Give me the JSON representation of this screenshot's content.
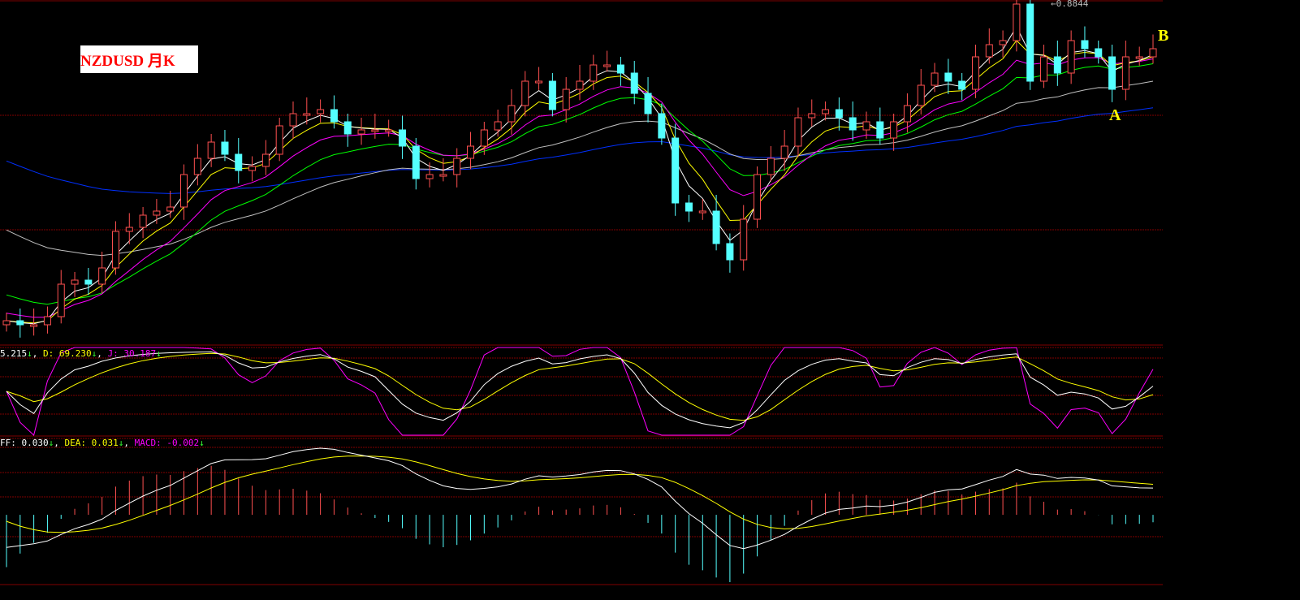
{
  "chart_data": {
    "type": "candlestick",
    "title": "NZDUSD 月K",
    "high_label": "0.8844",
    "annotations": [
      "A",
      "B"
    ],
    "closes": [
      0.416,
      0.41,
      0.41,
      0.422,
      0.47,
      0.476,
      0.47,
      0.494,
      0.548,
      0.554,
      0.572,
      0.578,
      0.584,
      0.632,
      0.656,
      0.68,
      0.662,
      0.638,
      0.644,
      0.662,
      0.704,
      0.722,
      0.722,
      0.728,
      0.71,
      0.692,
      0.698,
      0.698,
      0.698,
      0.674,
      0.626,
      0.632,
      0.632,
      0.656,
      0.674,
      0.698,
      0.71,
      0.734,
      0.77,
      0.77,
      0.728,
      0.758,
      0.77,
      0.794,
      0.794,
      0.782,
      0.752,
      0.722,
      0.686,
      0.59,
      0.578,
      0.578,
      0.53,
      0.506,
      0.566,
      0.632,
      0.656,
      0.674,
      0.716,
      0.722,
      0.728,
      0.716,
      0.698,
      0.71,
      0.686,
      0.71,
      0.734,
      0.764,
      0.782,
      0.77,
      0.758,
      0.806,
      0.824,
      0.83,
      0.884,
      0.77,
      0.806,
      0.782,
      0.83,
      0.818,
      0.806,
      0.758,
      0.806,
      0.806,
      0.818
    ],
    "kdj": {
      "k_text": "5.215",
      "d_text": "D: 69.230",
      "j_text": "J: 30.187",
      "arrow": "↓"
    },
    "macd": {
      "diff_text": "FF: 0.030",
      "dea_text": "DEA: 0.031",
      "macd_text": "MACD: -0.002",
      "arrow": "↓"
    },
    "colors": {
      "up": "#ff5050",
      "down": "#54ffff",
      "ma5": "#ffffff",
      "ma10": "#ffff00",
      "ma20": "#ff00ff",
      "ma30": "#00ff00",
      "ma60": "#c0c0c0",
      "ma120": "#0030ff",
      "grid": "#800000"
    }
  }
}
